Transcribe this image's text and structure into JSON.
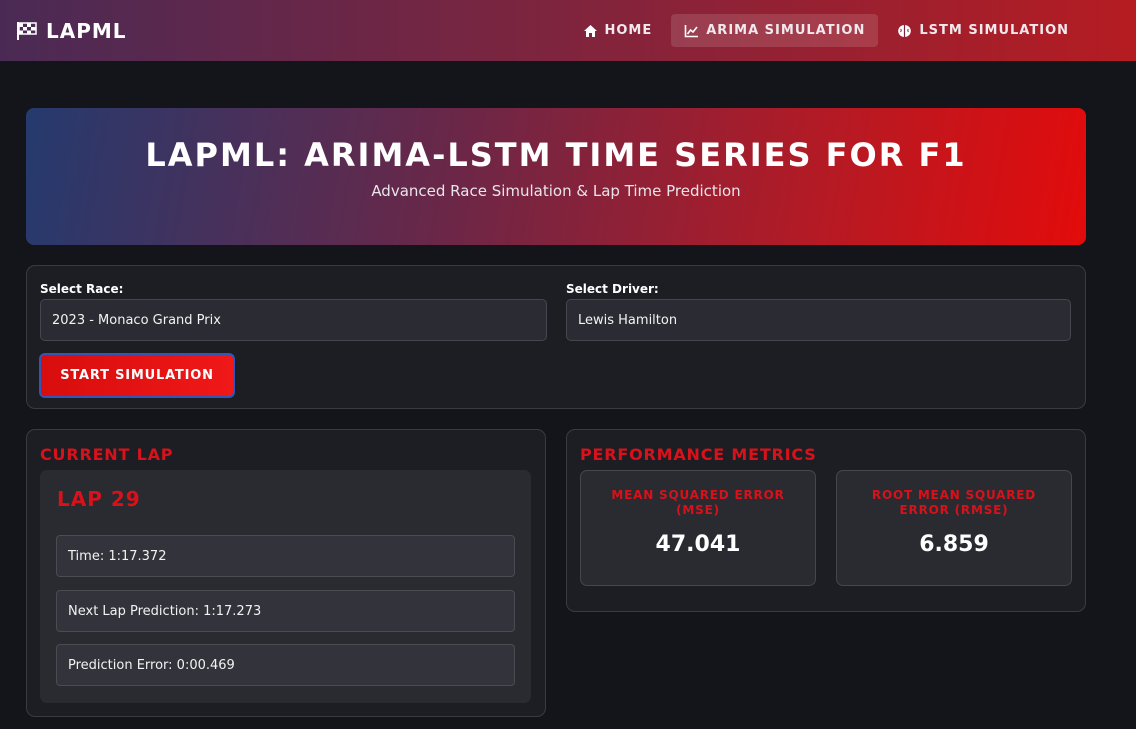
{
  "nav": {
    "brand": "LAPML",
    "links": [
      {
        "label": "HOME",
        "icon": "home-icon"
      },
      {
        "label": "ARIMA SIMULATION",
        "icon": "line-chart-icon",
        "active": true
      },
      {
        "label": "LSTM SIMULATION",
        "icon": "brain-icon"
      }
    ]
  },
  "hero": {
    "title": "LAPML: ARIMA-LSTM TIME SERIES FOR F1",
    "subtitle": "Advanced Race Simulation & Lap Time Prediction"
  },
  "controls": {
    "race_label": "Select Race:",
    "race_value": "2023 - Monaco Grand Prix",
    "driver_label": "Select Driver:",
    "driver_value": "Lewis Hamilton",
    "start_button": "START SIMULATION"
  },
  "current_lap": {
    "heading": "CURRENT LAP",
    "lap_title": "LAP 29",
    "time": "Time: 1:17.372",
    "next_prediction": "Next Lap Prediction: 1:17.273",
    "prediction_error": "Prediction Error: 0:00.469"
  },
  "metrics": {
    "heading": "PERFORMANCE METRICS",
    "items": [
      {
        "label": "MEAN SQUARED ERROR (MSE)",
        "value": "47.041"
      },
      {
        "label": "ROOT MEAN SQUARED ERROR (RMSE)",
        "value": "6.859"
      }
    ]
  },
  "colors": {
    "accent_red": "#d8111a",
    "background": "#14151a",
    "card": "#1d1e24"
  }
}
